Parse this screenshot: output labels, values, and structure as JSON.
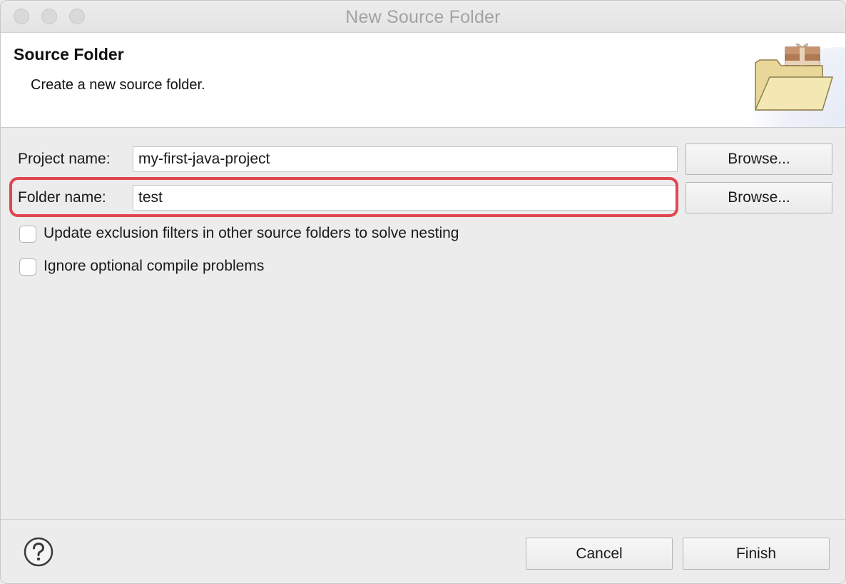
{
  "window": {
    "title": "New Source Folder"
  },
  "banner": {
    "title": "Source Folder",
    "description": "Create a new source folder.",
    "icon": "folder-with-package-icon"
  },
  "form": {
    "project_label": "Project name:",
    "project_value": "my-first-java-project",
    "project_browse": "Browse...",
    "folder_label": "Folder name:",
    "folder_value": "test",
    "folder_browse": "Browse...",
    "option_update_exclusion": {
      "label": "Update exclusion filters in other source folders to solve nesting",
      "checked": false
    },
    "option_ignore_optional": {
      "label": "Ignore optional compile problems",
      "checked": false
    }
  },
  "footer": {
    "help_icon": "help-icon",
    "cancel_label": "Cancel",
    "finish_label": "Finish"
  },
  "colors": {
    "highlight": "#e04650",
    "window_bg": "#ececec",
    "banner_bg": "#ffffff"
  }
}
